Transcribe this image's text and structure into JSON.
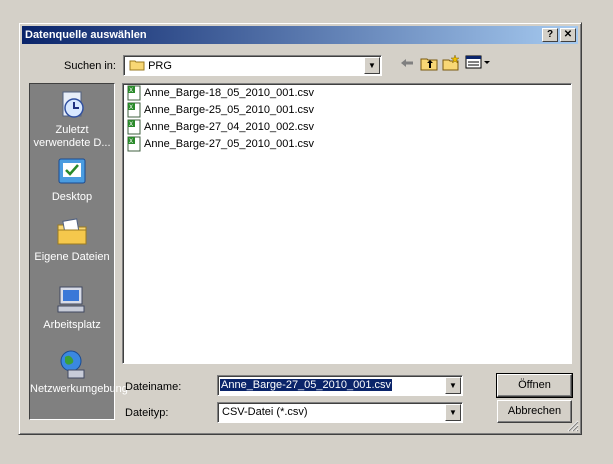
{
  "window": {
    "title": "Datenquelle auswählen",
    "help_label": "?",
    "close_label": "✕"
  },
  "toolbar": {
    "look_in_label": "Suchen in:",
    "look_in_value": "PRG",
    "back_icon": "back-arrow-icon",
    "up_icon": "folder-up-icon",
    "new_folder_icon": "new-folder-icon",
    "view_icon": "view-menu-icon"
  },
  "places": [
    {
      "label": "Zuletzt verwendete D...",
      "icon": "recent-documents-icon"
    },
    {
      "label": "Desktop",
      "icon": "desktop-icon"
    },
    {
      "label": "Eigene Dateien",
      "icon": "my-documents-icon"
    },
    {
      "label": "Arbeitsplatz",
      "icon": "my-computer-icon"
    },
    {
      "label": "Netzwerkumgebung",
      "icon": "network-icon"
    }
  ],
  "files": [
    "Anne_Barge-18_05_2010_001.csv",
    "Anne_Barge-25_05_2010_001.csv",
    "Anne_Barge-27_04_2010_002.csv",
    "Anne_Barge-27_05_2010_001.csv"
  ],
  "filename": {
    "label": "Dateiname:",
    "value": "Anne_Barge-27_05_2010_001.csv"
  },
  "filetype": {
    "label": "Dateityp:",
    "value": "CSV-Datei (*.csv)"
  },
  "buttons": {
    "open": "Öffnen",
    "cancel": "Abbrechen"
  },
  "colors": {
    "titlebar_start": "#0a246a",
    "titlebar_end": "#a6caf0",
    "face": "#d4d0c8",
    "places_bg": "#808080"
  }
}
